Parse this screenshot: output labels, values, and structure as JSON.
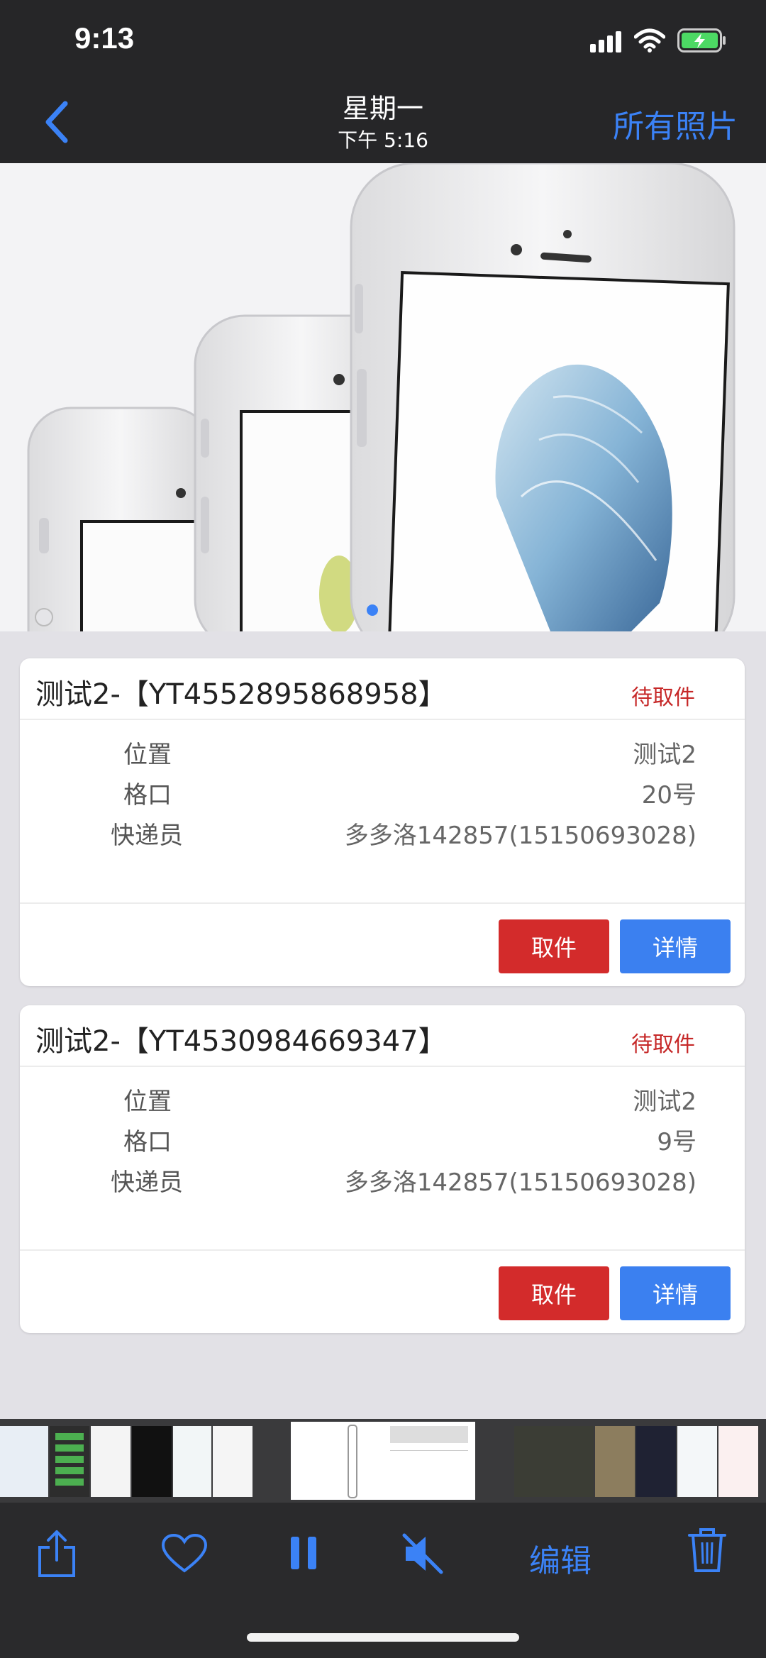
{
  "status_bar": {
    "time": "9:13"
  },
  "nav": {
    "title": "星期一",
    "subtitle": "下午 5:16",
    "right_label": "所有照片"
  },
  "cards": [
    {
      "title": "测试2-【YT4552895868958】",
      "status": "待取件",
      "rows": [
        {
          "label": "位置",
          "value": "测试2"
        },
        {
          "label": "格口",
          "value": "20号"
        },
        {
          "label": "快递员",
          "value": "多多洛142857(15150693028)"
        }
      ],
      "buttons": {
        "pickup": "取件",
        "details": "详情"
      }
    },
    {
      "title": "测试2-【YT4530984669347】",
      "status": "待取件",
      "rows": [
        {
          "label": "位置",
          "value": "测试2"
        },
        {
          "label": "格口",
          "value": "9号"
        },
        {
          "label": "快递员",
          "value": "多多洛142857(15150693028)"
        }
      ],
      "buttons": {
        "pickup": "取件",
        "details": "详情"
      }
    }
  ],
  "toolbar": {
    "edit_label": "编辑",
    "icons": [
      "share-icon",
      "heart-icon",
      "pause-icon",
      "mute-icon",
      "trash-icon"
    ]
  },
  "colors": {
    "accent": "#3b82f6",
    "danger": "#d32b2b",
    "status_red": "#c62828"
  }
}
